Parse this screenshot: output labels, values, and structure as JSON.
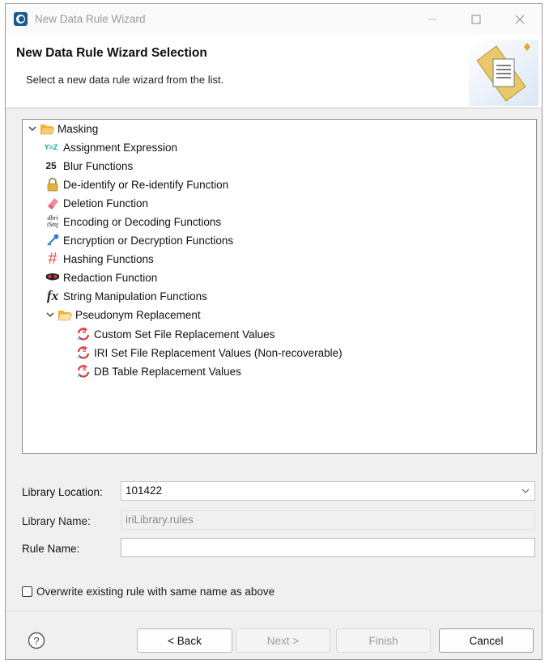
{
  "window": {
    "title": "New Data Rule Wizard"
  },
  "header": {
    "title": "New Data Rule Wizard Selection",
    "description": "Select a new data rule wizard from the list."
  },
  "tree": {
    "root": {
      "label": "Masking",
      "expanded": true,
      "icon": "folder-open-icon",
      "children": [
        {
          "label": "Assignment Expression",
          "icon": "assignment-icon",
          "glyph": "Y=Z"
        },
        {
          "label": "Blur Functions",
          "icon": "blur-icon",
          "glyph": "25"
        },
        {
          "label": "De-identify or Re-identify Function",
          "icon": "lock-icon"
        },
        {
          "label": "Deletion Function",
          "icon": "eraser-icon"
        },
        {
          "label": "Encoding or Decoding Functions",
          "icon": "encoding-icon",
          "glyph_top": "dhri",
          "glyph_bottom": "iSmj"
        },
        {
          "label": "Encryption or Decryption Functions",
          "icon": "key-icon"
        },
        {
          "label": "Hashing Functions",
          "icon": "hash-icon",
          "glyph": "#"
        },
        {
          "label": "Redaction Function",
          "icon": "redaction-icon"
        },
        {
          "label": "String Manipulation Functions",
          "icon": "function-icon",
          "glyph": "fx"
        }
      ],
      "subfolder": {
        "label": "Pseudonym Replacement",
        "expanded": true,
        "icon": "folder-open-icon",
        "children": [
          {
            "label": "Custom Set File Replacement Values",
            "icon": "replace-icon"
          },
          {
            "label": "IRI Set File Replacement Values (Non-recoverable)",
            "icon": "replace-icon"
          },
          {
            "label": "DB Table Replacement Values",
            "icon": "replace-icon"
          }
        ]
      }
    }
  },
  "form": {
    "library_location_label": "Library Location:",
    "library_location_value": "101422",
    "library_name_label": "Library Name:",
    "library_name_value": "iriLibrary.rules",
    "rule_name_label": "Rule Name:",
    "rule_name_value": "",
    "overwrite_label": "Overwrite existing rule with same name as above",
    "overwrite_checked": false
  },
  "buttons": {
    "help": "?",
    "back": "< Back",
    "next": "Next >",
    "finish": "Finish",
    "cancel": "Cancel"
  },
  "colors": {
    "folder": "#f2b43c",
    "accent_blue": "#1f6fb5",
    "hash": "#d9534f"
  }
}
